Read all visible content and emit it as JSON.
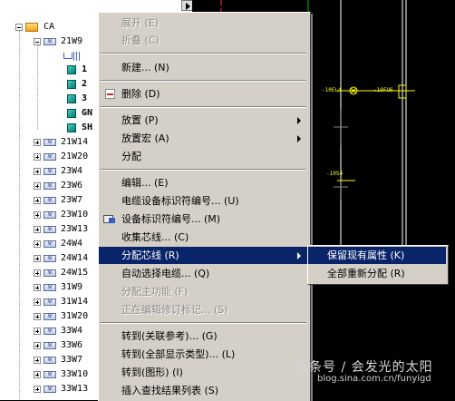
{
  "tree": {
    "root": "CA",
    "expanded": "21W9",
    "children": [
      "1",
      "2",
      "3",
      "GN",
      "SH"
    ],
    "items": [
      "21W14",
      "21W20",
      "23W4",
      "23W6",
      "23W7",
      "23W10",
      "23W13",
      "24W4",
      "24W14",
      "24W15",
      "31W9",
      "31W14",
      "31W20",
      "33W4",
      "33W6",
      "33W7",
      "33W10",
      "33W13"
    ]
  },
  "canvas": {
    "label_a": "-10EL4",
    "label_b": "-10FU6",
    "label_c": "-10S4"
  },
  "menu": {
    "items": [
      {
        "label": "展开 (E)",
        "disabled": true
      },
      {
        "label": "折叠 (C)",
        "disabled": true
      },
      {
        "label": "新建... (N)"
      },
      {
        "label": "删除 (D)"
      },
      {
        "label": "放置 (P)",
        "submenu": true
      },
      {
        "label": "放置宏 (A)",
        "submenu": true
      },
      {
        "label": "分配"
      },
      {
        "label": "编辑... (E)"
      },
      {
        "label": "电缆设备标识符编号... (U)"
      },
      {
        "label": "设备标识符编号... (M)"
      },
      {
        "label": "收集芯线... (C)"
      },
      {
        "label": "分配芯线 (R)",
        "submenu": true,
        "highlighted": true
      },
      {
        "label": "自动选择电缆... (Q)"
      },
      {
        "label": "分配主功能 (F)",
        "disabled": true
      },
      {
        "label": "正在编辑修订标记... (S)",
        "disabled": true
      },
      {
        "label": "转到(关联参考)... (G)"
      },
      {
        "label": "转到(全部显示类型)... (L)"
      },
      {
        "label": "转到(图形) (I)"
      },
      {
        "label": "插入查找结果列表 (S)"
      }
    ]
  },
  "submenu": {
    "items": [
      {
        "label": "保留现有属性 (K)",
        "highlighted": true
      },
      {
        "label": "全部重新分配 (R)"
      }
    ]
  },
  "watermark": {
    "main": "头条号 / 会发光的太阳",
    "url": "blog.sina.com.cn/funyigd"
  }
}
